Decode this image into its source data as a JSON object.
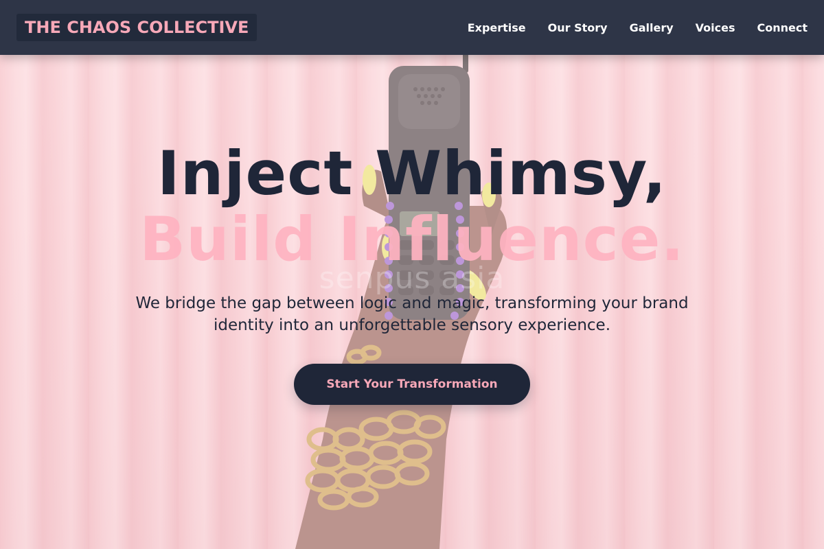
{
  "header": {
    "logo_text": "THE CHAOS COLLECTIVE",
    "nav": [
      {
        "label": "Expertise"
      },
      {
        "label": "Our Story"
      },
      {
        "label": "Gallery"
      },
      {
        "label": "Voices"
      },
      {
        "label": "Connect"
      }
    ]
  },
  "hero": {
    "headline_line1": "Inject Whimsy,",
    "headline_line2": "Build Influence.",
    "subtitle": "We bridge the gap between logic and magic, transforming your brand identity into an unforgettable sensory experience.",
    "cta_label": "Start Your Transformation",
    "background_watermark": "senpus asia"
  },
  "colors": {
    "header_bg": "#2e3547",
    "logo_text": "#f7a8b8",
    "dark_navy": "#1f2638",
    "accent_pink": "#ffb3c1",
    "curtain_pink": "#f6c9cf"
  }
}
